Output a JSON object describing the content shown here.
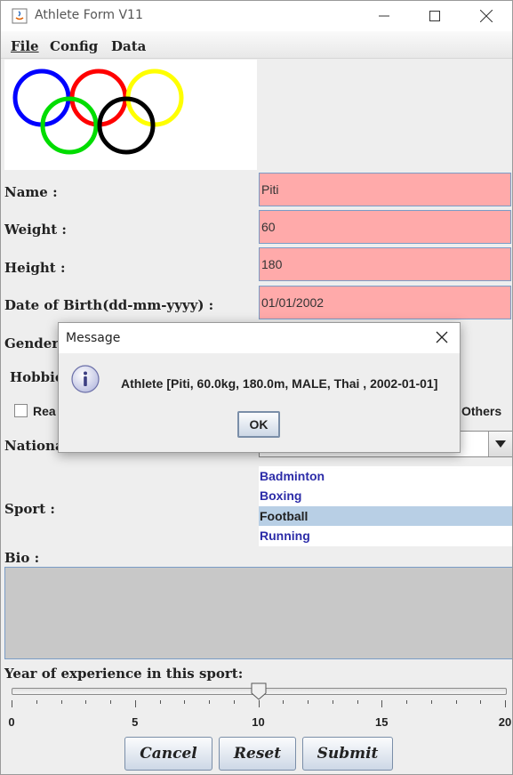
{
  "window": {
    "title": "Athlete Form V11"
  },
  "menu": {
    "file": "File",
    "config": "Config",
    "data": "Data"
  },
  "form": {
    "name_label": "Name :",
    "name_value": "Piti",
    "weight_label": "Weight :",
    "weight_value": "60",
    "height_label": "Height :",
    "height_value": "180",
    "dob_label": "Date of Birth(dd-mm-yyyy) :",
    "dob_value": "01/01/2002",
    "gender_label_partial": "Gender",
    "hobbies_label_partial": "Hobbie",
    "hobby_first_partial": "Rea",
    "hobby_last": "Others",
    "nationality_label_partial": "Nationa",
    "sport_label": "Sport :",
    "sports": [
      "Badminton",
      "Boxing",
      "Football",
      "Running"
    ],
    "selected_sport": "Football",
    "bio_label": "Bio :",
    "experience_label": "Year of experience in this sport:",
    "experience_value": 10,
    "slider_min": 0,
    "slider_max": 20,
    "slider_ticks": [
      "0",
      "5",
      "10",
      "15",
      "20"
    ]
  },
  "buttons": {
    "cancel": "Cancel",
    "reset": "Reset",
    "submit": "Submit"
  },
  "dialog": {
    "title": "Message",
    "message": "Athlete [Piti, 60.0kg, 180.0m, MALE, Thai , 2002-01-01]",
    "ok": "OK"
  },
  "colors": {
    "field_bg": "#ffaaaa",
    "list_selected_bg": "#b8cfe5",
    "list_text": "#2c2ca8",
    "ring_blue": "#0000ff",
    "ring_red": "#ff0000",
    "ring_yellow": "#ffff00",
    "ring_green": "#00dd00",
    "ring_black": "#000000"
  },
  "icons": {
    "app": "java-app-icon",
    "info": "info-icon",
    "dropdown": "chevron-down-icon"
  }
}
